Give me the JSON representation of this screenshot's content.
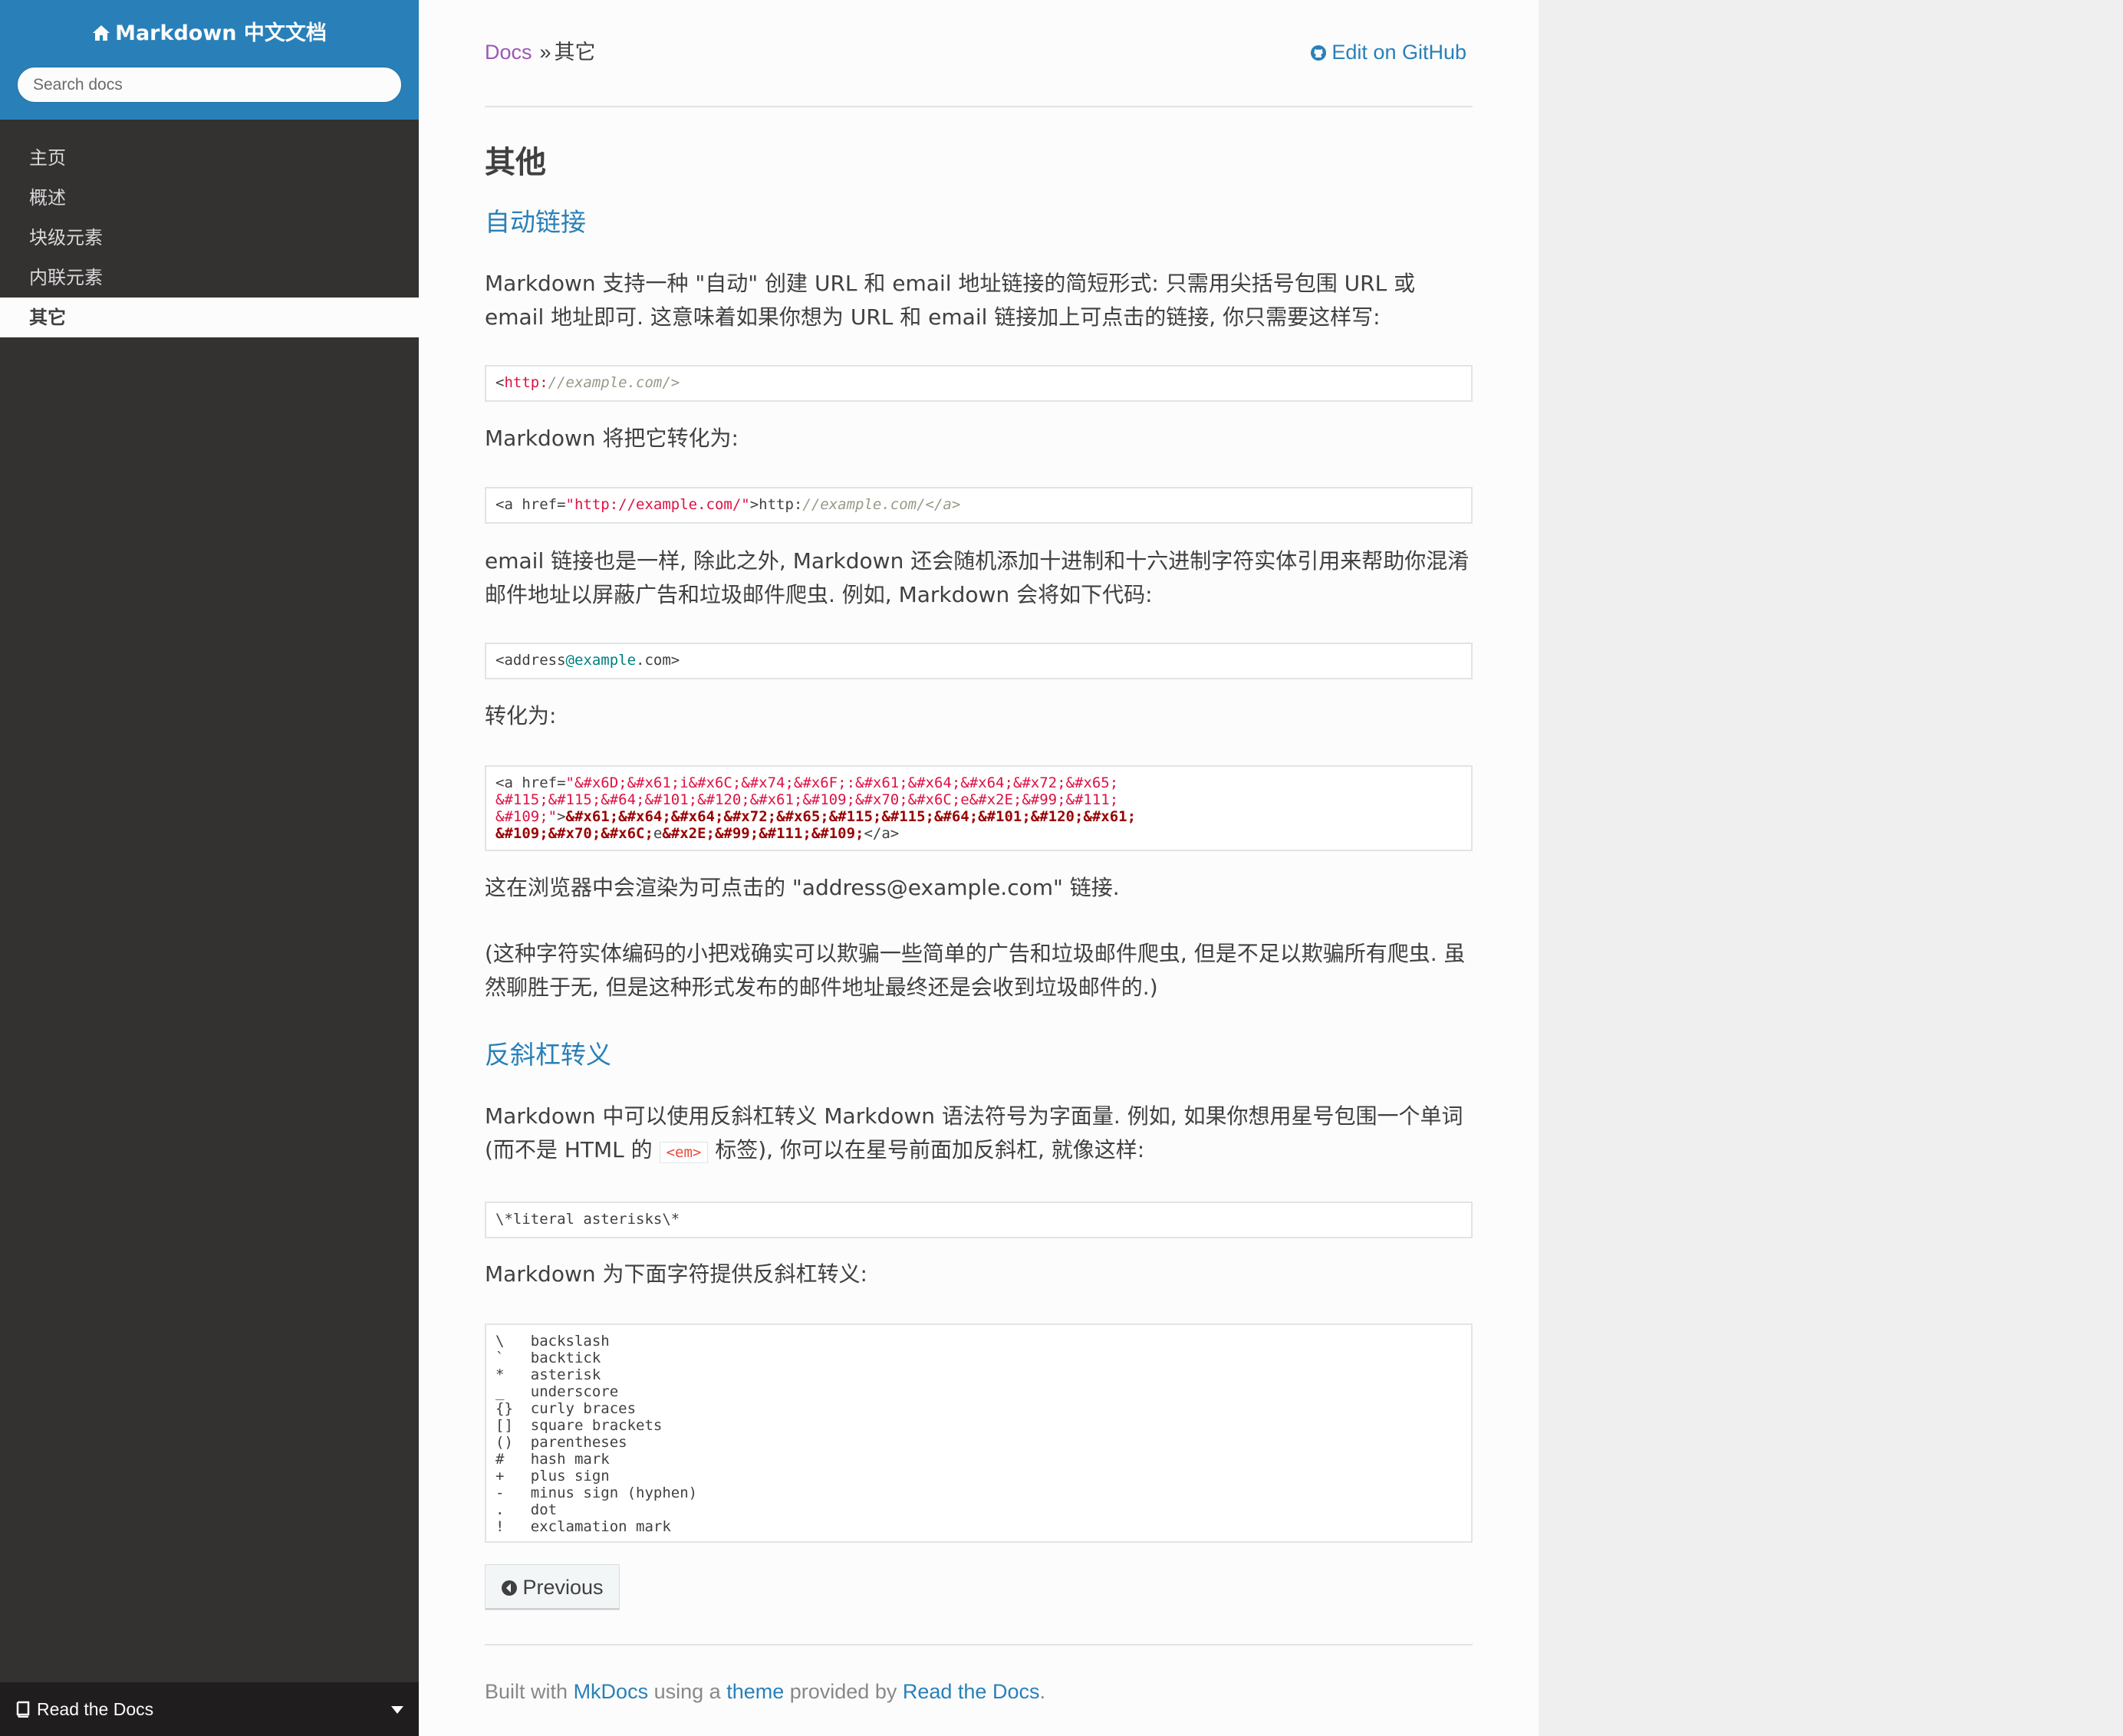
{
  "sidebar": {
    "site_title": "Markdown 中文文档",
    "search_placeholder": "Search docs",
    "nav_items": [
      {
        "label": "主页"
      },
      {
        "label": "概述"
      },
      {
        "label": "块级元素"
      },
      {
        "label": "内联元素"
      },
      {
        "label": "其它",
        "current": true
      }
    ],
    "versions_label": "Read the Docs"
  },
  "breadcrumbs": {
    "docs": "Docs",
    "separator": "»",
    "current": "其它",
    "edit_link": "Edit on GitHub"
  },
  "main": {
    "title": "其他",
    "sections": [
      {
        "heading": "自动链接",
        "p1": "Markdown 支持一种 \"自动\" 创建 URL 和 email 地址链接的简短形式: 只需用尖括号包围 URL 或 email 地址即可. 这意味着如果你想为 URL 和 email 链接加上可点击的链接, 你只需要这样写:",
        "code1_a": "<",
        "code1_b": "http:",
        "code1_c": "//example.com/>",
        "p2": "Markdown 将把它转化为:",
        "code2_a": "<a href=",
        "code2_b": "\"http://example.com/\"",
        "code2_c": ">http:",
        "code2_d": "//example.com/</a>",
        "p3": "email 链接也是一样, 除此之外, Markdown 还会随机添加十进制和十六进制字符实体引用来帮助你混淆邮件地址以屏蔽广告和垃圾邮件爬虫. 例如, Markdown 会将如下代码:",
        "code3_a": "<address",
        "code3_b": "@example",
        "code3_c": ".com>",
        "p4": "转化为:",
        "code4_l1a": "<a href=",
        "code4_l1b": "\"&#x6D;&#x61;i&#x6C;&#x74;&#x6F;:&#x61;&#x64;&#x64;&#x72;&#x65;",
        "code4_l2": "&#115;&#115;&#64;&#101;&#120;&#x61;&#109;&#x70;&#x6C;e&#x2E;&#99;&#111;",
        "code4_l3a": "&#109;\"",
        "code4_l3b": ">",
        "code4_l3c": "&#x61;&#x64;&#x64;&#x72;&#x65;&#115;&#115;&#64;&#101;&#120;&#x61;",
        "code4_l4a": "&#109;&#x70;&#x6C;",
        "code4_l4b": "e",
        "code4_l4c": "&#x2E;&#99;&#111;&#109;",
        "code4_l4d": "</a>",
        "p5": "这在浏览器中会渲染为可点击的 \"address@example.com\" 链接.",
        "p6": "(这种字符实体编码的小把戏确实可以欺骗一些简单的广告和垃圾邮件爬虫, 但是不足以欺骗所有爬虫. 虽然聊胜于无, 但是这种形式发布的邮件地址最终还是会收到垃圾邮件的.)"
      },
      {
        "heading": "反斜杠转义",
        "p1_a": "Markdown 中可以使用反斜杠转义 Markdown 语法符号为字面量. 例如, 如果你想用星号包围一个单词 (而不是 HTML 的",
        "p1_code": "<em>",
        "p1_b": "标签), 你可以在星号前面加反斜杠, 就像这样:",
        "code1": "\\*literal asterisks\\*",
        "p2": "Markdown 为下面字符提供反斜杠转义:",
        "code2": "\\   backslash\n`   backtick\n*   asterisk\n_   underscore\n{}  curly braces\n[]  square brackets\n()  parentheses\n#   hash mark\n+   plus sign\n-   minus sign (hyphen)\n.   dot\n!   exclamation mark"
      }
    ],
    "previous_button": "Previous"
  },
  "footer": {
    "built_with": "Built with",
    "mkdocs": "MkDocs",
    "using_a": "using a",
    "theme": "theme",
    "provided_by": "provided by",
    "rtd": "Read the Docs",
    "period": "."
  },
  "colors": {
    "sidebar_bg": "#343131",
    "header_bg": "#2980b9",
    "link": "#2980b9",
    "visited_link": "#9b59b6",
    "text": "#404040"
  }
}
